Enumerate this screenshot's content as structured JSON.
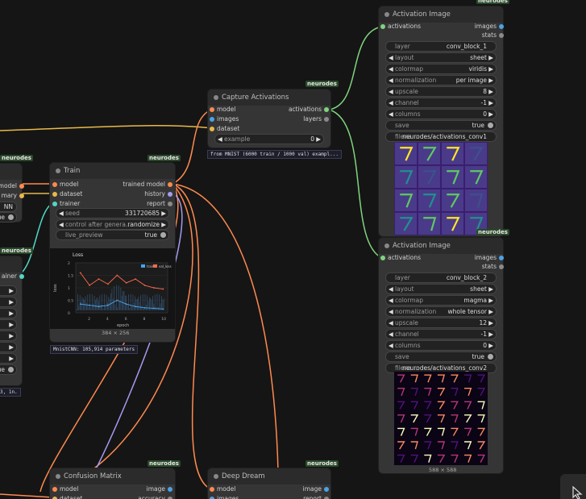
{
  "badge_label": "neurodes",
  "colors": {
    "orange": "#ff8a4f",
    "yellow": "#e8b84c",
    "cyan": "#52d6c8",
    "green": "#7fd47f",
    "purple": "#a59bf0",
    "blue": "#4aa3e6",
    "gray": "#8a8a8a"
  },
  "left_edge": {
    "model": "model",
    "summary": "mary",
    "cnn": "NN",
    "trainer": "ainer",
    "footer": "3, 1n."
  },
  "train": {
    "title": "Train",
    "inputs": [
      "model",
      "dataset",
      "trainer"
    ],
    "outputs": [
      "trained model",
      "history",
      "report"
    ],
    "seed": {
      "label": "seed",
      "value": "331720685"
    },
    "control": {
      "label": "control after genera...",
      "value": "randomize"
    },
    "live_preview": {
      "label": "live_preview",
      "value": "true"
    },
    "plot_dims": "384 × 256",
    "info": "MnistCNN: 105,914 parameters"
  },
  "capture": {
    "title": "Capture Activations",
    "inputs": [
      "model",
      "images",
      "dataset"
    ],
    "outputs": [
      "activations",
      "layers"
    ],
    "example": {
      "label": "example",
      "value": "0"
    },
    "info": "from MNIST (6000 train / 1000 val) exampl..."
  },
  "act1": {
    "title": "Activation Image",
    "input": "activations",
    "outputs": [
      "images",
      "stats"
    ],
    "widgets": [
      {
        "label": "layer",
        "value": "conv_block_1",
        "kind": "text"
      },
      {
        "label": "layout",
        "value": "sheet",
        "kind": "combo"
      },
      {
        "label": "colormap",
        "value": "viridis",
        "kind": "combo"
      },
      {
        "label": "normalization",
        "value": "per image",
        "kind": "combo"
      },
      {
        "label": "upscale",
        "value": "8",
        "kind": "num"
      },
      {
        "label": "channel",
        "value": "-1",
        "kind": "num"
      },
      {
        "label": "columns",
        "value": "0",
        "kind": "num"
      },
      {
        "label": "save",
        "value": "true",
        "kind": "toggle"
      },
      {
        "label": "filena ...",
        "value": "neurodes/activations_conv1",
        "kind": "text"
      }
    ]
  },
  "act2": {
    "title": "Activation Image",
    "input": "activations",
    "outputs": [
      "images",
      "stats"
    ],
    "widgets": [
      {
        "label": "layer",
        "value": "conv_block_2",
        "kind": "text"
      },
      {
        "label": "layout",
        "value": "sheet",
        "kind": "combo"
      },
      {
        "label": "colormap",
        "value": "magma",
        "kind": "combo"
      },
      {
        "label": "normalization",
        "value": "whole tensor",
        "kind": "combo"
      },
      {
        "label": "upscale",
        "value": "12",
        "kind": "num"
      },
      {
        "label": "channel",
        "value": "-1",
        "kind": "num"
      },
      {
        "label": "columns",
        "value": "0",
        "kind": "num"
      },
      {
        "label": "save",
        "value": "true",
        "kind": "toggle"
      },
      {
        "label": "filena ...",
        "value": "neurodes/activations_conv2",
        "kind": "text"
      }
    ],
    "dims": "588 × 588"
  },
  "confusion": {
    "title": "Confusion Matrix",
    "inputs": [
      "model",
      "dataset"
    ],
    "outputs": [
      "image",
      "accuracy"
    ]
  },
  "dream": {
    "title": "Deep Dream",
    "inputs": [
      "model",
      "images"
    ],
    "outputs": [
      "image",
      "report"
    ]
  },
  "chart_data": {
    "type": "line",
    "title": "Loss",
    "xlabel": "epoch",
    "ylabel": "loss",
    "legend": [
      "train",
      "val_loss"
    ],
    "legend_position": "top-right",
    "x_ticks": [
      "2",
      "4",
      "6",
      "8",
      "10"
    ],
    "y_ticks": [
      "2",
      "1.5",
      "1",
      "0.5",
      "0"
    ],
    "series": [
      {
        "name": "val_loss",
        "x": [
          1,
          2,
          3,
          4,
          5,
          6,
          7,
          8,
          9,
          10
        ],
        "values": [
          1.6,
          1.1,
          1.35,
          1.15,
          1.5,
          1.2,
          1.35,
          1.1,
          1.0,
          0.95
        ]
      },
      {
        "name": "train",
        "x": [
          1,
          2,
          3,
          4,
          5,
          6,
          7,
          8,
          9,
          10
        ],
        "values": [
          0.35,
          0.3,
          0.25,
          0.3,
          0.5,
          0.35,
          0.25,
          0.2,
          0.18,
          0.15
        ]
      }
    ]
  }
}
